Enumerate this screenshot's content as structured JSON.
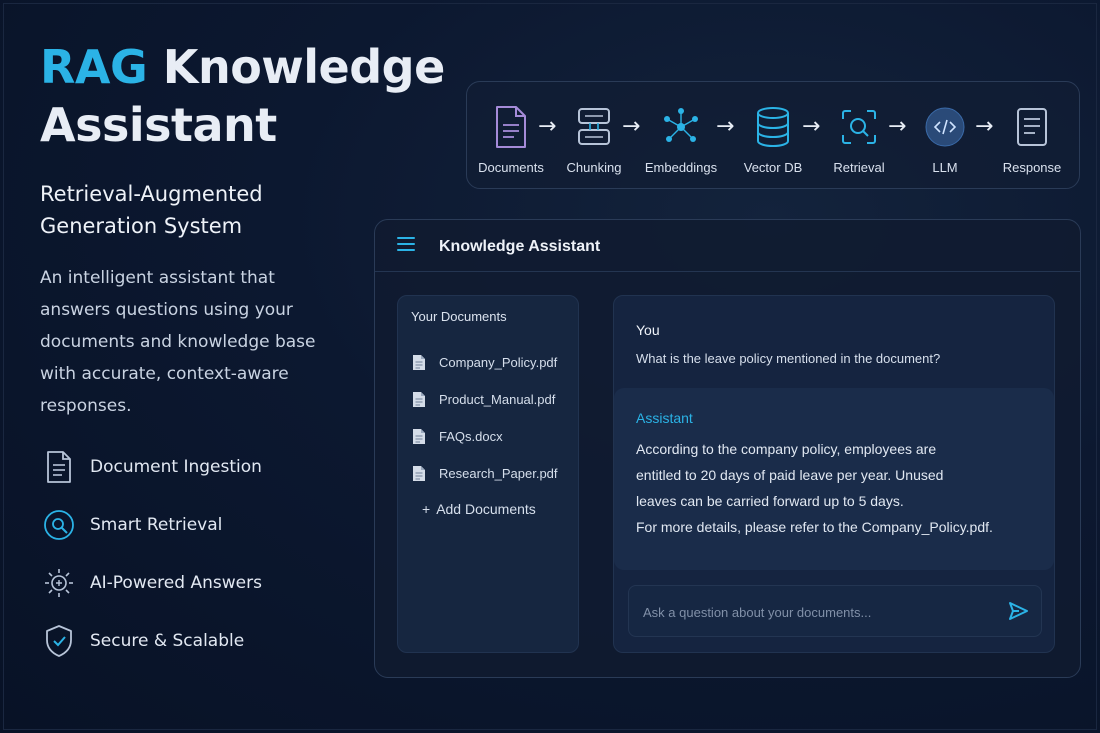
{
  "hero": {
    "title_accent": "RAG",
    "title_rest_line1": " Knowledge",
    "title_line2": "Assistant",
    "subtitle_line1": "Retrieval-Augmented",
    "subtitle_line2": "Generation System",
    "description_lines": [
      "An intelligent assistant that",
      "answers questions using your",
      "documents and knowledge base",
      "with accurate, context-aware",
      "responses."
    ]
  },
  "features": [
    {
      "icon": "document-icon",
      "label": "Document Ingestion"
    },
    {
      "icon": "search-icon",
      "label": "Smart Retrieval"
    },
    {
      "icon": "brain-icon",
      "label": "AI-Powered Answers"
    },
    {
      "icon": "shield-icon",
      "label": "Secure & Scalable"
    }
  ],
  "pipeline": {
    "steps": [
      {
        "icon": "document-icon",
        "label": "Documents"
      },
      {
        "icon": "chunking-icon",
        "label": "Chunking"
      },
      {
        "icon": "embeddings-icon",
        "label": "Embeddings"
      },
      {
        "icon": "database-icon",
        "label": "Vector DB"
      },
      {
        "icon": "retrieval-icon",
        "label": "Retrieval"
      },
      {
        "icon": "llm-icon",
        "label": "LLM"
      },
      {
        "icon": "response-icon",
        "label": "Response"
      }
    ],
    "arrow": "→"
  },
  "app": {
    "title": "Knowledge Assistant",
    "docs_heading": "Your Documents",
    "documents": [
      "Company_Policy.pdf",
      "Product_Manual.pdf",
      "FAQs.docx",
      "Research_Paper.pdf"
    ],
    "add_label": "Add Documents",
    "add_symbol": "+",
    "chat": {
      "user_label": "You",
      "user_message": "What is the leave policy mentioned in the document?",
      "assistant_label": "Assistant",
      "assistant_lines": [
        "According to the company policy, employees are",
        "entitled to 20 days of paid leave per year. Unused",
        "leaves can be carried forward up to 5 days.",
        "For more details, please refer to the Company_Policy.pdf."
      ],
      "input_value": "",
      "input_placeholder": "Ask a question about your documents..."
    }
  },
  "colors": {
    "accent": "#2bb3e6",
    "background": "#0c1830",
    "panel": "#162640",
    "purple_icon": "#a58bd9"
  }
}
